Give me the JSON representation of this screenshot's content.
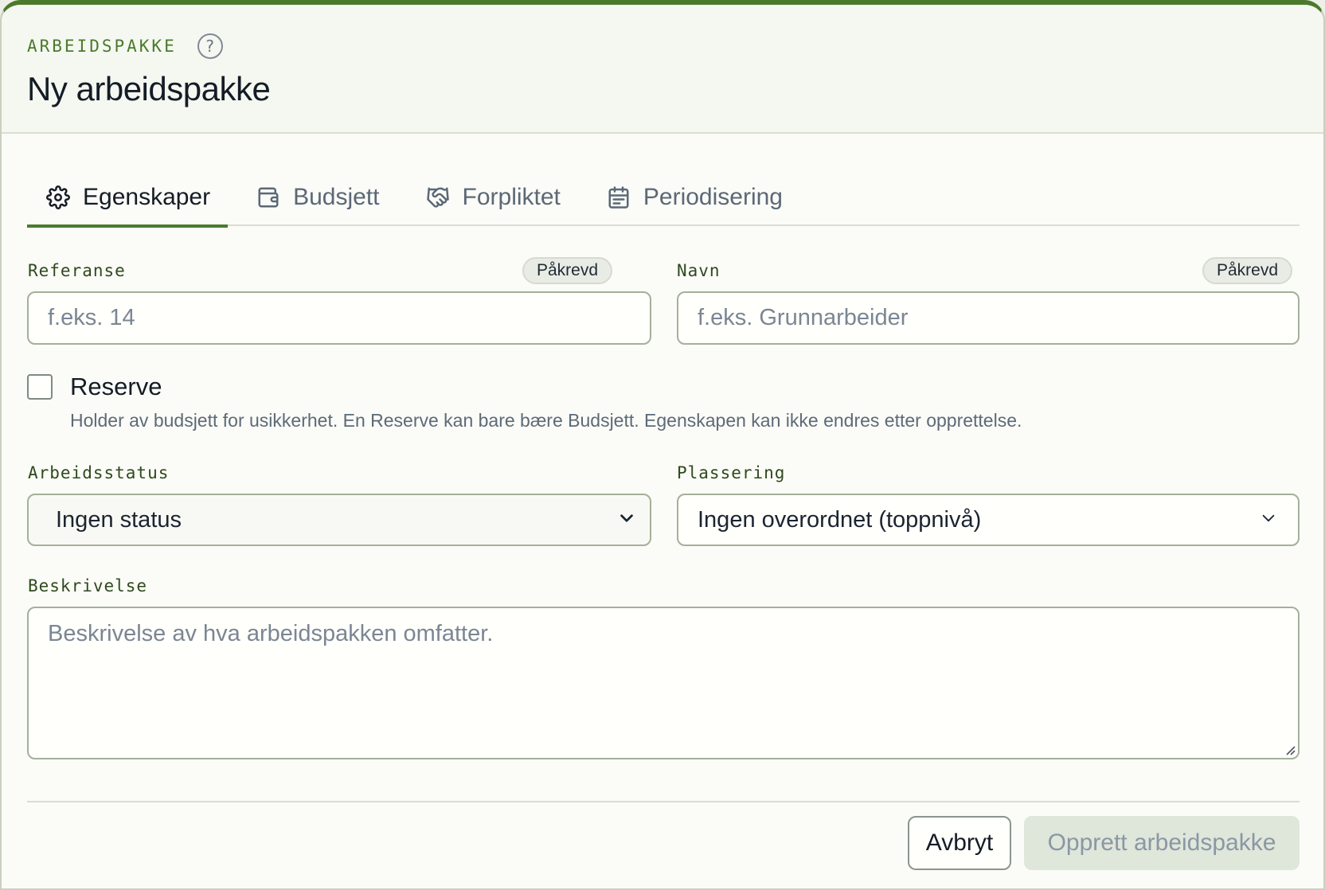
{
  "header": {
    "eyebrow": "ARBEIDSPAKKE",
    "help_icon": "question-circle-icon",
    "title": "Ny arbeidspakke"
  },
  "tabs": [
    {
      "label": "Egenskaper",
      "icon": "gear-icon",
      "active": true
    },
    {
      "label": "Budsjett",
      "icon": "wallet-icon",
      "active": false
    },
    {
      "label": "Forpliktet",
      "icon": "handshake-icon",
      "active": false
    },
    {
      "label": "Periodisering",
      "icon": "calendar-icon",
      "active": false
    }
  ],
  "form": {
    "reference": {
      "label": "Referanse",
      "badge": "Påkrevd",
      "placeholder": "f.eks. 14",
      "value": ""
    },
    "name": {
      "label": "Navn",
      "badge": "Påkrevd",
      "placeholder": "f.eks. Grunnarbeider",
      "value": ""
    },
    "reserve": {
      "label": "Reserve",
      "checked": false,
      "help": "Holder av budsjett for usikkerhet. En Reserve kan bare bære Budsjett. Egenskapen kan ikke endres etter opprettelse."
    },
    "work_status": {
      "label": "Arbeidsstatus",
      "selected": "Ingen status"
    },
    "placement": {
      "label": "Plassering",
      "selected": "Ingen overordnet (toppnivå)"
    },
    "description": {
      "label": "Beskrivelse",
      "placeholder": "Beskrivelse av hva arbeidspakken omfatter.",
      "value": ""
    }
  },
  "footer": {
    "cancel_label": "Avbryt",
    "submit_label": "Opprett arbeidspakke",
    "submit_disabled": true
  },
  "colors": {
    "accent": "#4b7a2c",
    "background": "#fbfbf7",
    "muted_text": "#5d6a78"
  }
}
